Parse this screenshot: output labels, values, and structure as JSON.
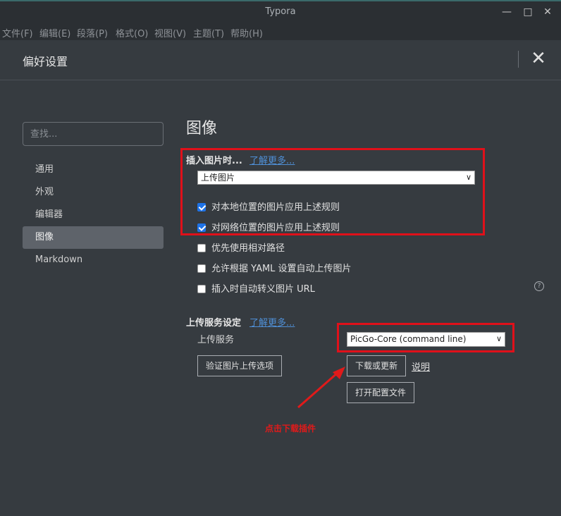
{
  "window": {
    "title": "Typora",
    "minimize_icon": "minimize-icon",
    "maximize_icon": "maximize-icon",
    "close_icon": "close-icon"
  },
  "menu": [
    "文件(F)",
    "编辑(E)",
    "段落(P)",
    "格式(O)",
    "视图(V)",
    "主题(T)",
    "帮助(H)"
  ],
  "preferences": {
    "title": "偏好设置",
    "search_placeholder": "查找..."
  },
  "sidebar": {
    "items": [
      {
        "label": "通用",
        "active": false
      },
      {
        "label": "外观",
        "active": false
      },
      {
        "label": "编辑器",
        "active": false
      },
      {
        "label": "图像",
        "active": true
      },
      {
        "label": "Markdown",
        "active": false
      }
    ]
  },
  "image_section": {
    "title": "图像",
    "insert_label": "插入图片时...",
    "learn_more": "了解更多...",
    "insert_select_value": "上传图片",
    "checkboxes": [
      {
        "label": "对本地位置的图片应用上述规则",
        "checked": true
      },
      {
        "label": "对网络位置的图片应用上述规则",
        "checked": true
      },
      {
        "label": "优先使用相对路径",
        "checked": false
      },
      {
        "label": "允许根据 YAML 设置自动上传图片",
        "checked": false
      },
      {
        "label": "插入时自动转义图片 URL",
        "checked": false
      }
    ],
    "help_icon": "help-icon"
  },
  "upload_section": {
    "title": "上传服务设定",
    "learn_more": "了解更多...",
    "service_label": "上传服务",
    "service_value": "PicGo-Core (command line)",
    "verify_button": "验证图片上传选项",
    "download_button": "下载或更新",
    "explain_link": "说明",
    "open_config_button": "打开配置文件"
  },
  "annotation": {
    "text": "点击下载插件",
    "color": "#E01A1A"
  },
  "colors": {
    "background": "#363B40",
    "accent_link": "#4F8FD6",
    "checkbox_checked": "#1E73E8",
    "highlight_box": "#E0101A"
  }
}
